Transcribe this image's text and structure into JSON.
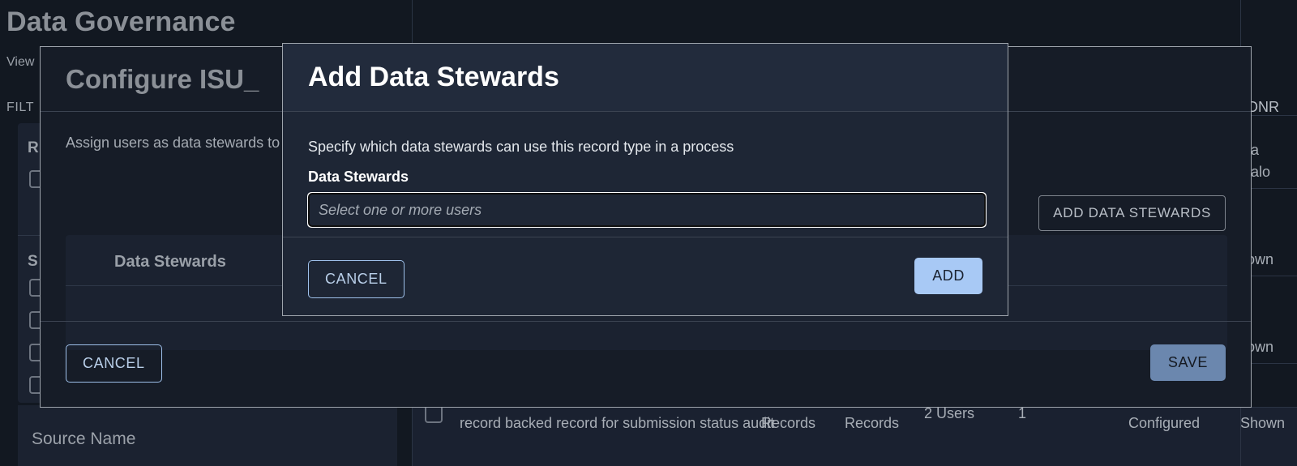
{
  "page": {
    "title": "Data Governance",
    "view_label": "View",
    "filter_label": "FILT",
    "source_name_label": "Source Name",
    "filter_panel": {
      "section_record": "R",
      "section_source": "S",
      "checkbox_count": 5
    }
  },
  "background_table": {
    "partial_header": "ONR",
    "rows": [
      {
        "description": "record backed record for submission status audit",
        "records_a": "Records",
        "records_b": "Records",
        "users": "2 Users",
        "count": "1",
        "status": "Configured",
        "shown": "Shown"
      }
    ],
    "right_column_fragments": [
      "ta",
      "talo",
      "t",
      "own",
      "t",
      "own"
    ]
  },
  "configure_dialog": {
    "title": "Configure ISU_",
    "assign_text": "Assign users as data stewards to",
    "add_stewards_button": "ADD DATA STEWARDS",
    "table_header": "Data Stewards",
    "cancel_button": "CANCEL",
    "save_button": "SAVE"
  },
  "add_dialog": {
    "title": "Add Data Stewards",
    "description": "Specify which data stewards can use this record type in a process",
    "field_label": "Data Stewards",
    "field_value": "",
    "field_placeholder": "Select one or more users",
    "cancel_button": "CANCEL",
    "add_button": "ADD"
  },
  "colors": {
    "page_bg": "#121821",
    "panel_bg": "#1b2230",
    "dialog_bg": "#1e2635",
    "dialog_header_bg": "#222b3c",
    "accent_blue": "#a8c9f5",
    "accent_border": "#9ec0ea",
    "muted_button": "#6b87ae",
    "dim_text": "#8b9097"
  }
}
